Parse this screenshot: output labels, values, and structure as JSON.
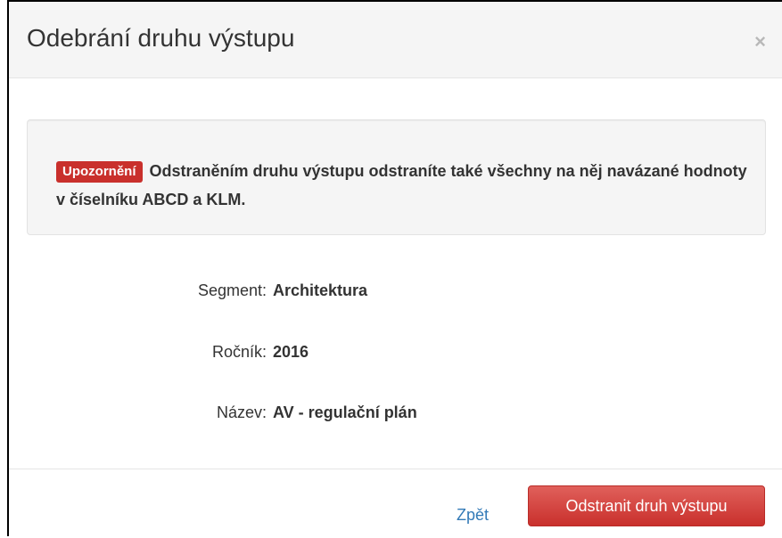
{
  "modal": {
    "title": "Odebrání druhu výstupu",
    "close_symbol": "×"
  },
  "alert": {
    "badge": "Upozornění",
    "message": "Odstraněním druhu výstupu odstraníte také všechny na něj navázané hodnoty v číselníku ABCD a KLM."
  },
  "fields": [
    {
      "label": "Segment:",
      "value": "Architektura"
    },
    {
      "label": "Ročník:",
      "value": "2016"
    },
    {
      "label": "Název:",
      "value": "AV - regulační plán"
    }
  ],
  "footer": {
    "back_label": "Zpět",
    "delete_label": "Odstranit druh výstupu"
  },
  "colors": {
    "danger": "#d9534f",
    "badge": "#c9302c",
    "link": "#337ab7"
  },
  "icons": {
    "close": "close-icon"
  }
}
